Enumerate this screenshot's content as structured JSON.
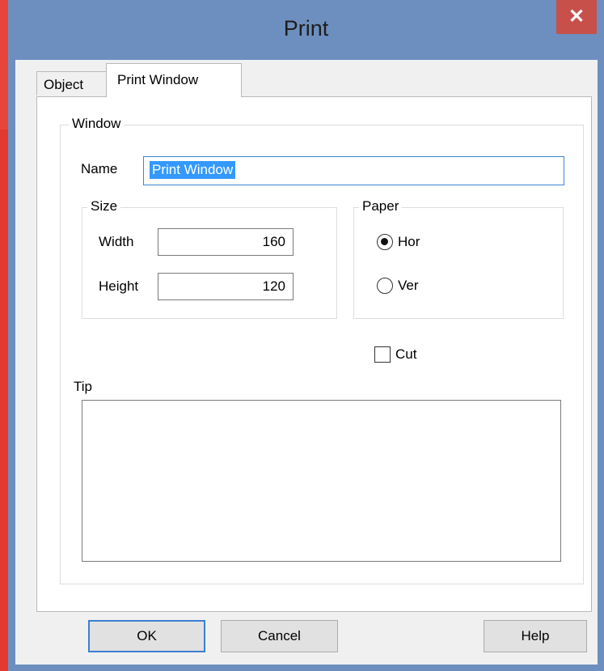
{
  "window": {
    "title": "Print",
    "close_symbol": "✕"
  },
  "tabs": [
    {
      "label": "Object"
    },
    {
      "label": "Print Window"
    }
  ],
  "window_group": {
    "legend": "Window",
    "name_label": "Name",
    "name_value": "Print Window"
  },
  "size_group": {
    "legend": "Size",
    "width_label": "Width",
    "width_value": "160",
    "height_label": "Height",
    "height_value": "120"
  },
  "paper_group": {
    "legend": "Paper",
    "options": [
      {
        "label": "Hor",
        "selected": true
      },
      {
        "label": "Ver",
        "selected": false
      }
    ]
  },
  "cut": {
    "label": "Cut",
    "checked": false
  },
  "tip": {
    "label": "Tip",
    "value": ""
  },
  "buttons": {
    "ok": "OK",
    "cancel": "Cancel",
    "help": "Help"
  },
  "colors": {
    "title_bar": "#6d8fbf",
    "close_button": "#c7504a",
    "selection": "#3399ff",
    "desktop": "#e23a2e"
  },
  "icons": {
    "close": "close-icon",
    "radio_selected": "radio-selected-icon",
    "radio_unselected": "radio-unselected-icon",
    "checkbox": "checkbox-unchecked-icon"
  }
}
